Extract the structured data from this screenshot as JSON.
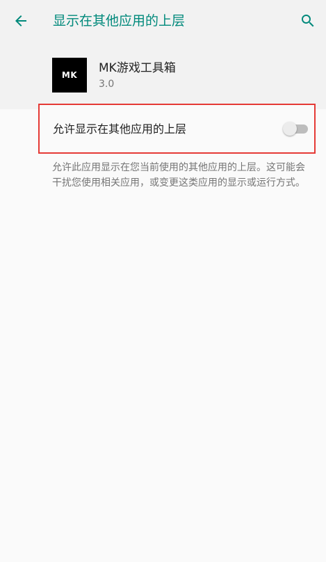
{
  "toolbar": {
    "title": "显示在其他应用的上层",
    "back_icon": "arrow-back-icon",
    "search_icon": "search-icon"
  },
  "app": {
    "icon_text": "MK",
    "name": "MK游戏工具箱",
    "version": "3.0"
  },
  "setting": {
    "label": "允许显示在其他应用的上层",
    "enabled": false
  },
  "description": "允许此应用显示在您当前使用的其他应用的上层。这可能会干扰您使用相关应用，或变更这类应用的显示或运行方式。",
  "colors": {
    "accent": "#00897b",
    "highlight_border": "#e53935",
    "switch_track_off": "#bdbdbd",
    "switch_thumb_off": "#ececec"
  }
}
